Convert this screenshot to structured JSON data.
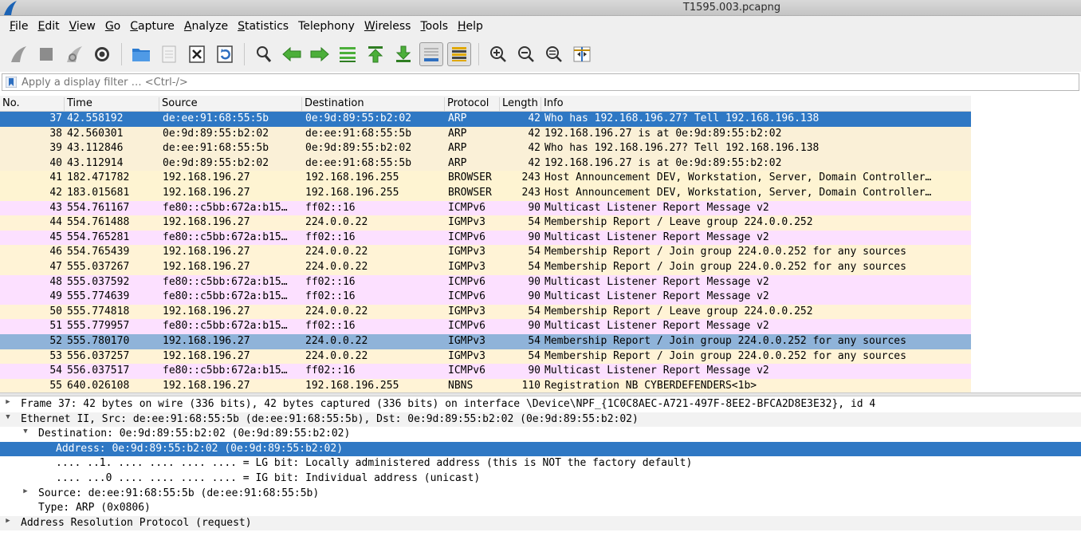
{
  "window": {
    "title": "T1595.003.pcapng"
  },
  "menu": [
    {
      "label": "File",
      "u": "F",
      "rest": "ile"
    },
    {
      "label": "Edit",
      "u": "E",
      "rest": "dit"
    },
    {
      "label": "View",
      "u": "V",
      "rest": "iew"
    },
    {
      "label": "Go",
      "u": "G",
      "rest": "o"
    },
    {
      "label": "Capture",
      "u": "C",
      "rest": "apture"
    },
    {
      "label": "Analyze",
      "u": "A",
      "rest": "nalyze"
    },
    {
      "label": "Statistics",
      "u": "S",
      "rest": "tatistics"
    },
    {
      "label": "Telephony",
      "u": "",
      "rest": "Telephony"
    },
    {
      "label": "Wireless",
      "u": "W",
      "rest": "ireless"
    },
    {
      "label": "Tools",
      "u": "T",
      "rest": "ools"
    },
    {
      "label": "Help",
      "u": "H",
      "rest": "elp"
    }
  ],
  "toolbar_icons": [
    "shark-fin-start-icon",
    "stop-square-icon",
    "restart-fin-icon",
    "capture-options-gear-icon",
    "open-folder-icon",
    "save-file-icon",
    "close-file-icon",
    "reload-file-icon",
    "find-magnifier-icon",
    "go-back-arrow-icon",
    "go-forward-arrow-icon",
    "go-to-packet-icon",
    "go-first-packet-icon",
    "go-last-packet-icon",
    "autoscroll-icon",
    "colorize-icon",
    "zoom-in-icon",
    "zoom-out-icon",
    "zoom-normal-icon",
    "resize-columns-icon"
  ],
  "filter": {
    "placeholder": "Apply a display filter … <Ctrl-/>"
  },
  "columns": {
    "no": "No.",
    "time": "Time",
    "source": "Source",
    "destination": "Destination",
    "protocol": "Protocol",
    "length": "Length",
    "info": "Info"
  },
  "colors": {
    "arp": "#faf0d7",
    "browser": "#fef4d2",
    "icmpv6": "#fce0ff",
    "igmp": "#fff3d6",
    "nbns": "#fff3d6",
    "selected": "#2f78c4",
    "highlight": "#8fb3d9"
  },
  "packets": [
    {
      "no": "37",
      "time": "42.558192",
      "src": "de:ee:91:68:55:5b",
      "dst": "0e:9d:89:55:b2:02",
      "proto": "ARP",
      "len": "42",
      "info": "Who has 192.168.196.27? Tell 192.168.196.138",
      "kind": "selected"
    },
    {
      "no": "38",
      "time": "42.560301",
      "src": "0e:9d:89:55:b2:02",
      "dst": "de:ee:91:68:55:5b",
      "proto": "ARP",
      "len": "42",
      "info": "192.168.196.27 is at 0e:9d:89:55:b2:02",
      "kind": "arp"
    },
    {
      "no": "39",
      "time": "43.112846",
      "src": "de:ee:91:68:55:5b",
      "dst": "0e:9d:89:55:b2:02",
      "proto": "ARP",
      "len": "42",
      "info": "Who has 192.168.196.27? Tell 192.168.196.138",
      "kind": "arp"
    },
    {
      "no": "40",
      "time": "43.112914",
      "src": "0e:9d:89:55:b2:02",
      "dst": "de:ee:91:68:55:5b",
      "proto": "ARP",
      "len": "42",
      "info": "192.168.196.27 is at 0e:9d:89:55:b2:02",
      "kind": "arp"
    },
    {
      "no": "41",
      "time": "182.471782",
      "src": "192.168.196.27",
      "dst": "192.168.196.255",
      "proto": "BROWSER",
      "len": "243",
      "info": "Host Announcement DEV, Workstation, Server, Domain Controller…",
      "kind": "browser"
    },
    {
      "no": "42",
      "time": "183.015681",
      "src": "192.168.196.27",
      "dst": "192.168.196.255",
      "proto": "BROWSER",
      "len": "243",
      "info": "Host Announcement DEV, Workstation, Server, Domain Controller…",
      "kind": "browser"
    },
    {
      "no": "43",
      "time": "554.761167",
      "src": "fe80::c5bb:672a:b15…",
      "dst": "ff02::16",
      "proto": "ICMPv6",
      "len": "90",
      "info": "Multicast Listener Report Message v2",
      "kind": "icmpv6"
    },
    {
      "no": "44",
      "time": "554.761488",
      "src": "192.168.196.27",
      "dst": "224.0.0.22",
      "proto": "IGMPv3",
      "len": "54",
      "info": "Membership Report / Leave group 224.0.0.252",
      "kind": "igmp"
    },
    {
      "no": "45",
      "time": "554.765281",
      "src": "fe80::c5bb:672a:b15…",
      "dst": "ff02::16",
      "proto": "ICMPv6",
      "len": "90",
      "info": "Multicast Listener Report Message v2",
      "kind": "icmpv6"
    },
    {
      "no": "46",
      "time": "554.765439",
      "src": "192.168.196.27",
      "dst": "224.0.0.22",
      "proto": "IGMPv3",
      "len": "54",
      "info": "Membership Report / Join group 224.0.0.252 for any sources",
      "kind": "igmp"
    },
    {
      "no": "47",
      "time": "555.037267",
      "src": "192.168.196.27",
      "dst": "224.0.0.22",
      "proto": "IGMPv3",
      "len": "54",
      "info": "Membership Report / Join group 224.0.0.252 for any sources",
      "kind": "igmp"
    },
    {
      "no": "48",
      "time": "555.037592",
      "src": "fe80::c5bb:672a:b15…",
      "dst": "ff02::16",
      "proto": "ICMPv6",
      "len": "90",
      "info": "Multicast Listener Report Message v2",
      "kind": "icmpv6"
    },
    {
      "no": "49",
      "time": "555.774639",
      "src": "fe80::c5bb:672a:b15…",
      "dst": "ff02::16",
      "proto": "ICMPv6",
      "len": "90",
      "info": "Multicast Listener Report Message v2",
      "kind": "icmpv6"
    },
    {
      "no": "50",
      "time": "555.774818",
      "src": "192.168.196.27",
      "dst": "224.0.0.22",
      "proto": "IGMPv3",
      "len": "54",
      "info": "Membership Report / Leave group 224.0.0.252",
      "kind": "igmp"
    },
    {
      "no": "51",
      "time": "555.779957",
      "src": "fe80::c5bb:672a:b15…",
      "dst": "ff02::16",
      "proto": "ICMPv6",
      "len": "90",
      "info": "Multicast Listener Report Message v2",
      "kind": "icmpv6"
    },
    {
      "no": "52",
      "time": "555.780170",
      "src": "192.168.196.27",
      "dst": "224.0.0.22",
      "proto": "IGMPv3",
      "len": "54",
      "info": "Membership Report / Join group 224.0.0.252 for any sources",
      "kind": "highlight"
    },
    {
      "no": "53",
      "time": "556.037257",
      "src": "192.168.196.27",
      "dst": "224.0.0.22",
      "proto": "IGMPv3",
      "len": "54",
      "info": "Membership Report / Join group 224.0.0.252 for any sources",
      "kind": "igmp"
    },
    {
      "no": "54",
      "time": "556.037517",
      "src": "fe80::c5bb:672a:b15…",
      "dst": "ff02::16",
      "proto": "ICMPv6",
      "len": "90",
      "info": "Multicast Listener Report Message v2",
      "kind": "icmpv6"
    },
    {
      "no": "55",
      "time": "640.026108",
      "src": "192.168.196.27",
      "dst": "192.168.196.255",
      "proto": "NBNS",
      "len": "110",
      "info": "Registration NB CYBERDEFENDERS<1b>",
      "kind": "nbns"
    }
  ],
  "details": [
    {
      "text": "Frame 37: 42 bytes on wire (336 bits), 42 bytes captured (336 bits) on interface \\Device\\NPF_{1C0C8AEC-A721-497F-8EE2-BFCA2D8E3E32}, id 4",
      "level": 0,
      "arrow": "collapsed",
      "shade": false,
      "selected": false
    },
    {
      "text": "Ethernet II, Src: de:ee:91:68:55:5b (de:ee:91:68:55:5b), Dst: 0e:9d:89:55:b2:02 (0e:9d:89:55:b2:02)",
      "level": 0,
      "arrow": "expanded",
      "shade": true,
      "selected": false
    },
    {
      "text": "Destination: 0e:9d:89:55:b2:02 (0e:9d:89:55:b2:02)",
      "level": 1,
      "arrow": "expanded",
      "shade": false,
      "selected": false
    },
    {
      "text": "Address: 0e:9d:89:55:b2:02 (0e:9d:89:55:b2:02)",
      "level": 2,
      "arrow": "none",
      "shade": false,
      "selected": true
    },
    {
      "text": ".... ..1. .... .... .... .... = LG bit: Locally administered address (this is NOT the factory default)",
      "level": 2,
      "arrow": "none",
      "shade": false,
      "selected": false
    },
    {
      "text": ".... ...0 .... .... .... .... = IG bit: Individual address (unicast)",
      "level": 2,
      "arrow": "none",
      "shade": false,
      "selected": false
    },
    {
      "text": "Source: de:ee:91:68:55:5b (de:ee:91:68:55:5b)",
      "level": 1,
      "arrow": "collapsed",
      "shade": false,
      "selected": false
    },
    {
      "text": "Type: ARP (0x0806)",
      "level": 1,
      "arrow": "none",
      "shade": false,
      "selected": false
    },
    {
      "text": "Address Resolution Protocol (request)",
      "level": 0,
      "arrow": "collapsed",
      "shade": true,
      "selected": false
    }
  ]
}
